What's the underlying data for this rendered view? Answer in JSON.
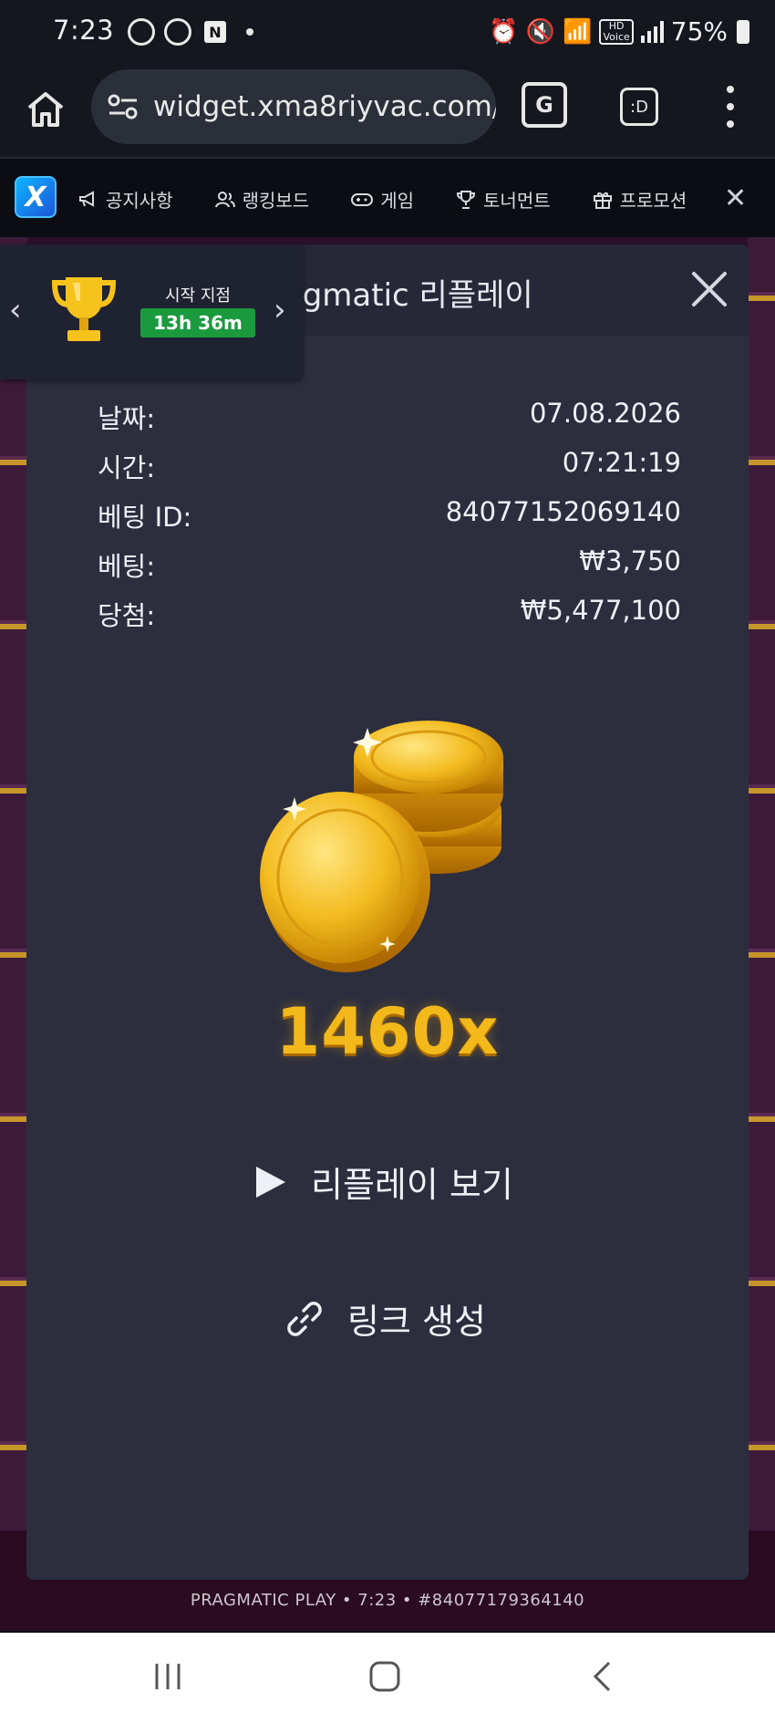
{
  "status_bar": {
    "time": "7:23",
    "battery": "75%",
    "hd_badge": "HD"
  },
  "browser": {
    "url": "widget.xma8riyvac.com/",
    "tab_button": ":D"
  },
  "site_nav": {
    "logo": "X",
    "items": [
      {
        "label": "공지사항",
        "icon": "megaphone-icon"
      },
      {
        "label": "랭킹보드",
        "icon": "users-icon"
      },
      {
        "label": "게임",
        "icon": "gamepad-icon"
      },
      {
        "label": "토너먼트",
        "icon": "trophy-icon"
      },
      {
        "label": "프로모션",
        "icon": "gift-icon"
      }
    ]
  },
  "tournament_widget": {
    "label": "시작 지점",
    "timer": "13h 36m"
  },
  "modal": {
    "title": "Pragmatic 리플레이",
    "rows": [
      {
        "label": "날짜:",
        "value": "07.08.2026"
      },
      {
        "label": "시간:",
        "value": "07:21:19"
      },
      {
        "label": "베팅 ID:",
        "value": "84077152069140"
      },
      {
        "label": "베팅:",
        "value": "₩3,750"
      },
      {
        "label": "당첨:",
        "value": "₩5,477,100"
      }
    ],
    "multiplier": "1460x",
    "replay_label": "리플레이 보기",
    "link_label": "링크 생성"
  },
  "footer": {
    "info": "PRAGMATIC PLAY • 7:23 • #84077179364140"
  },
  "colors": {
    "modal_bg": "#2c2e3e",
    "timer_bg": "#1a9a3d",
    "multiplier_gold": "#f3b81a"
  }
}
